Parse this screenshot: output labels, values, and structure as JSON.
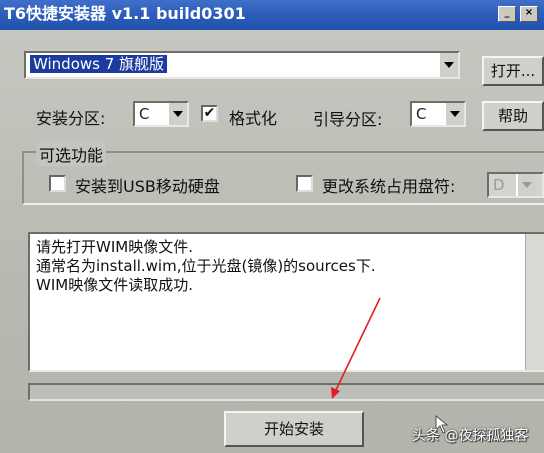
{
  "window": {
    "title": "T6快捷安装器 v1.1 build0301"
  },
  "os_select": {
    "value": "Windows 7 旗舰版"
  },
  "buttons": {
    "open": "打开...",
    "help": "帮助",
    "start": "开始安装"
  },
  "install_partition": {
    "label": "安装分区:",
    "value": "C"
  },
  "format": {
    "label": "格式化",
    "checked": true
  },
  "boot_partition": {
    "label": "引导分区:",
    "value": "C"
  },
  "optional": {
    "title": "可选功能",
    "usb": {
      "label": "安装到USB移动硬盘",
      "checked": false
    },
    "drive_letter": {
      "label": "更改系统占用盘符:",
      "checked": false,
      "value": "D"
    }
  },
  "log_lines": [
    "请先打开WIM映像文件.",
    "通常名为install.wim,位于光盘(镜像)的sources下.",
    "WIM映像文件读取成功."
  ],
  "progress": {
    "percent": 0
  },
  "watermark": "头条 @夜探孤独客",
  "colors": {
    "annotation_arrow": "#e02020",
    "titlebar": "#2a5bb8",
    "selection": "#1c3b9e"
  }
}
